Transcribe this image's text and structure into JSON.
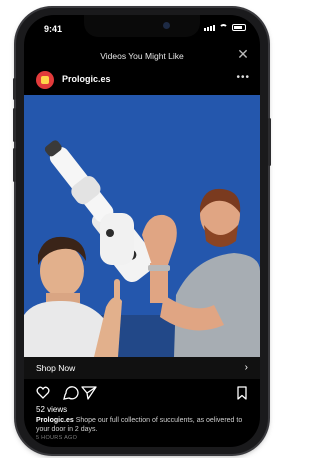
{
  "status": {
    "time": "9:41"
  },
  "header": {
    "title": "Videos You Might Like",
    "close_icon": "close-icon"
  },
  "post": {
    "handle": "Prologic.es",
    "more_icon": "more-icon",
    "photo_alt": "Two men holding a white robotic arm against a blue background"
  },
  "shop": {
    "label": "Shop Now",
    "arrow_icon": "chevron-right-icon"
  },
  "actions": {
    "like_icon": "heart-icon",
    "comment_icon": "comment-icon",
    "share_icon": "send-icon",
    "save_icon": "bookmark-icon"
  },
  "views": "52 views",
  "caption": {
    "handle": "Prologic.es",
    "text": "Shope our full collection of succulents, as oelivered to your door in 2 days."
  },
  "timestamp": "5 HOURS AGO",
  "colors": {
    "photo_bg": "#2a5fb8",
    "avatar": "#e23b3b"
  }
}
